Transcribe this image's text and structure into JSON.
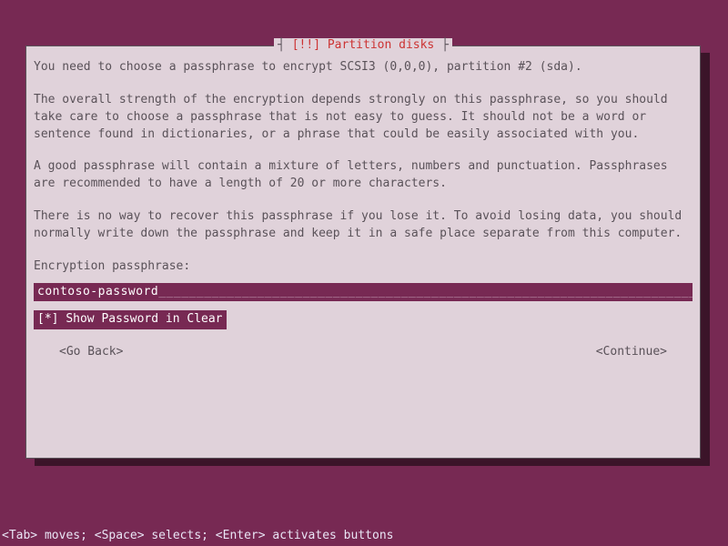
{
  "dialog": {
    "title_prefix": "┤ ",
    "title_alert": "[!!]",
    "title_text": " Partition disks",
    "title_suffix": " ├",
    "para1": "You need to choose a passphrase to encrypt SCSI3 (0,0,0), partition #2 (sda).",
    "para2": "The overall strength of the encryption depends strongly on this passphrase, so you should take care to choose a passphrase that is not easy to guess. It should not be a word or sentence found in dictionaries, or a phrase that could be easily associated with you.",
    "para3": "A good passphrase will contain a mixture of letters, numbers and punctuation. Passphrases are recommended to have a length of 20 or more characters.",
    "para4": "There is no way to recover this passphrase if you lose it. To avoid losing data, you should normally write down the passphrase and keep it in a safe place separate from this computer.",
    "prompt_label": "Encryption passphrase:",
    "input_value": "contoso-password",
    "input_fill": "____________________________________________________________________________",
    "show_password_checkbox": "[*]",
    "show_password_label": "Show Password in Clear",
    "go_back": "<Go Back>",
    "continue": "<Continue>"
  },
  "statusbar": "<Tab> moves; <Space> selects; <Enter> activates buttons"
}
